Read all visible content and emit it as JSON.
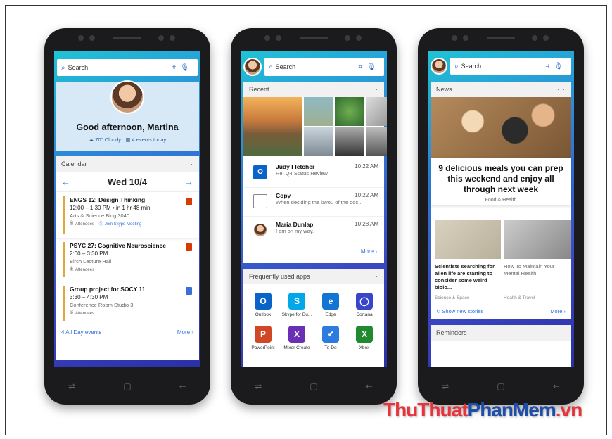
{
  "phone1": {
    "search_placeholder": "Search",
    "greeting": "Good afternoon, Martina",
    "weather": "70° Cloudy",
    "events_today": "4 events today",
    "calendar": {
      "title": "Calendar",
      "date": "Wed 10/4",
      "events": [
        {
          "title": "ENGS 12: Design Thinking",
          "time": "12:00 – 1:30 PM • in 1 hr 48 min",
          "location": "Arts & Science Bldg 3040",
          "attendees": "Attendees",
          "join": "Join Skype Meeting"
        },
        {
          "title": "PSYC 27: Cognitive Neuroscience",
          "time": "2:00 – 3:30 PM",
          "location": "Birch Lecture Hall",
          "attendees": "Attendees"
        },
        {
          "title": "Group project for SOCY 11",
          "time": "3:30 – 4:30 PM",
          "location": "Conference Room Studio 3",
          "attendees": "Attendees"
        }
      ],
      "all_day": "4 All Day events",
      "more": "More"
    }
  },
  "phone2": {
    "search_placeholder": "Search",
    "recent_title": "Recent",
    "emails": [
      {
        "sender": "Judy Fletcher",
        "subject": "Re: Q4 Status Review",
        "time": "10:22 AM"
      },
      {
        "sender": "Copy",
        "subject": "When deciding the layou of the doc...",
        "time": "10:22 AM"
      },
      {
        "sender": "Maria Dunlap",
        "subject": "I am on my way.",
        "time": "10:28 AM"
      }
    ],
    "more": "More",
    "apps_title": "Frequently used apps",
    "apps": [
      {
        "name": "Outlook",
        "icon": "O",
        "color": "#0a64c8"
      },
      {
        "name": "Skype for Bu...",
        "icon": "S",
        "color": "#00a8ea"
      },
      {
        "name": "Edge",
        "icon": "e",
        "color": "#1374d4"
      },
      {
        "name": "Cortana",
        "icon": "◯",
        "color": "#3a46c9"
      },
      {
        "name": "PowerPoint",
        "icon": "P",
        "color": "#d24726"
      },
      {
        "name": "Mixer Create",
        "icon": "X",
        "color": "#6a2fb4"
      },
      {
        "name": "To-Do",
        "icon": "✔",
        "color": "#2d7be0"
      },
      {
        "name": "Xbox",
        "icon": "X",
        "color": "#1f8a2f"
      }
    ]
  },
  "phone3": {
    "search_placeholder": "Search",
    "news_title": "News",
    "headline": "9 delicious meals you can prep this weekend and enjoy all through next week",
    "headline_category": "Food & Health",
    "stories": [
      {
        "title": "Scientists searching for alien life are starting to consider some weird biolo...",
        "category": "Science & Space"
      },
      {
        "title": "How To Maintain Your Mental Health",
        "category": "Health & Travel"
      }
    ],
    "show_new": "Show new stories",
    "more": "More",
    "reminders_title": "Reminders"
  },
  "watermark": {
    "part1": "ThuThuat",
    "part2": "PhanMem",
    "part3": ".vn"
  },
  "colors": {
    "accent": "#2b6fd6",
    "watermark_red": "#e8323c",
    "watermark_blue": "#1e4ea8"
  }
}
